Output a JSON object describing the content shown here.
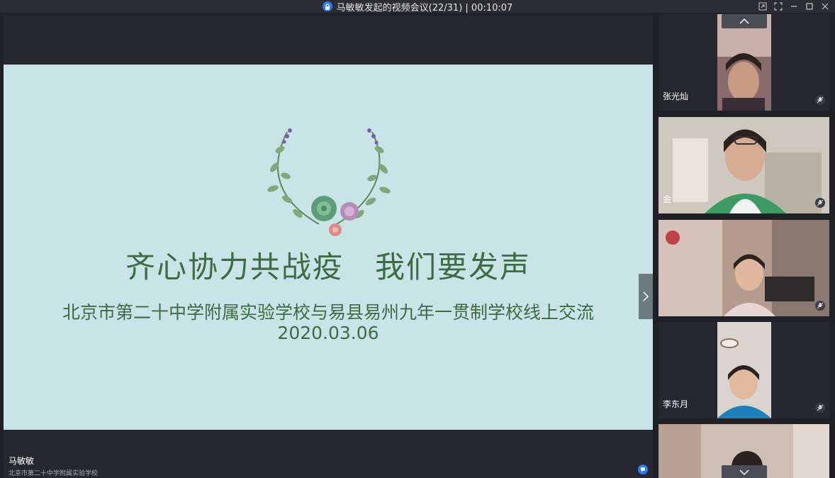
{
  "window": {
    "title": "马敏敏发起的视频会议(22/31) | 00:10:07"
  },
  "slide": {
    "title": "齐心协力共战疫　我们要发声",
    "subtitle": "北京市第二十中学附属实验学校与易县易州九年一贯制学校线上交流",
    "date": "2020.03.06"
  },
  "presenter": {
    "name": "马敏敏",
    "organization": "北京市第二十中学附属实验学校"
  },
  "participants": [
    {
      "name": "张光灿"
    },
    {
      "name": "金"
    },
    {
      "name": ""
    },
    {
      "name": "李东月"
    },
    {
      "name": ""
    }
  ],
  "colors": {
    "accent": "#2f7bf5",
    "slide_bg": "#c9e4e6",
    "slide_text": "#3d6b44"
  }
}
